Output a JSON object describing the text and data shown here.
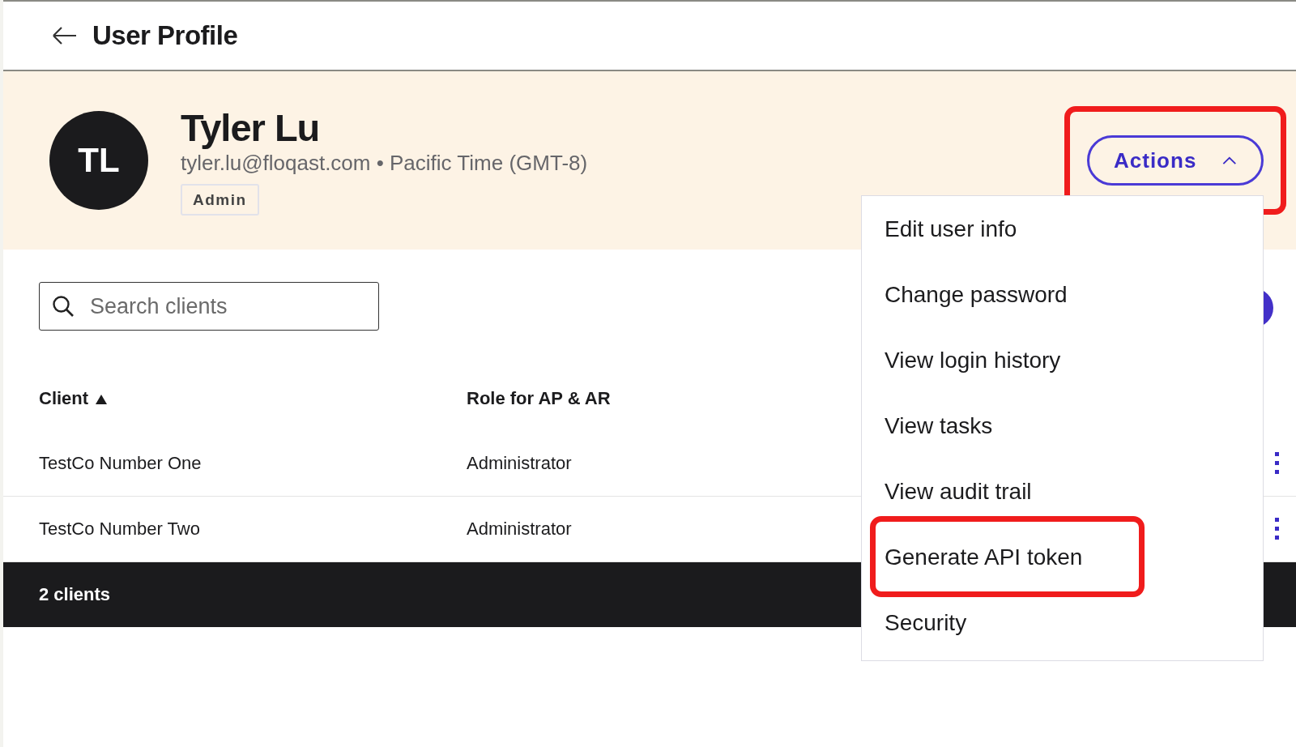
{
  "header": {
    "title": "User Profile"
  },
  "user": {
    "initials": "TL",
    "name": "Tyler Lu",
    "details": "tyler.lu@floqast.com • Pacific Time (GMT-8)",
    "role_badge": "Admin"
  },
  "actions_button": {
    "label": "Actions",
    "expanded": true,
    "highlighted": true
  },
  "actions_menu": [
    {
      "label": "Edit user info",
      "highlighted": false
    },
    {
      "label": "Change password",
      "highlighted": false
    },
    {
      "label": "View login history",
      "highlighted": false
    },
    {
      "label": "View tasks",
      "highlighted": false
    },
    {
      "label": "View audit trail",
      "highlighted": false
    },
    {
      "label": "Generate API token",
      "highlighted": true
    },
    {
      "label": "Security",
      "highlighted": false
    }
  ],
  "search": {
    "placeholder": "Search clients"
  },
  "table": {
    "columns": [
      {
        "label": "Client",
        "sorted": true
      },
      {
        "label": "Role for AP & AR",
        "sorted": false
      }
    ],
    "rows": [
      [
        "TestCo Number One",
        "Administrator"
      ],
      [
        "TestCo Number Two",
        "Administrator"
      ]
    ],
    "footer": "2 clients"
  }
}
